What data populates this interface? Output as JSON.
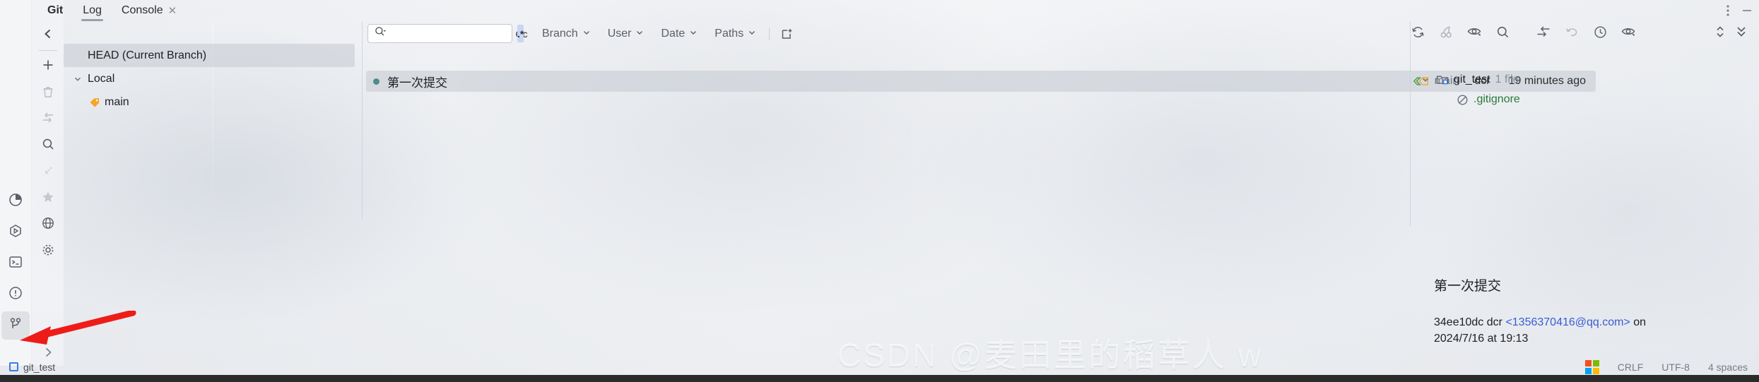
{
  "window": {
    "title": "Git",
    "tabs": [
      {
        "label": "Log",
        "selected": true,
        "closable": false
      },
      {
        "label": "Console",
        "selected": false,
        "closable": true
      }
    ],
    "more_options_icon": "vertical-dots-icon",
    "minimize_icon": "minimize-icon"
  },
  "tool_strip": {
    "items": [
      {
        "icon": "pie-chart-icon",
        "name": "project-statistics",
        "active": false
      },
      {
        "icon": "run-hexagon-icon",
        "name": "run-panel",
        "active": false
      },
      {
        "icon": "terminal-icon",
        "name": "terminal-panel",
        "active": false
      },
      {
        "icon": "problems-icon",
        "name": "problems-panel",
        "active": false
      },
      {
        "icon": "git-branch-icon",
        "name": "git-panel",
        "active": true
      }
    ]
  },
  "side_toolbar": {
    "items": [
      {
        "icon": "chevron-left-icon",
        "name": "collapse-panel",
        "dim": false
      },
      {
        "icon": "plus-icon",
        "name": "new-branch",
        "dim": false
      },
      {
        "icon": "trash-icon",
        "name": "delete-branch",
        "dim": true
      },
      {
        "icon": "merge-arrow-icon",
        "name": "merge-branch",
        "dim": true
      },
      {
        "icon": "search-icon",
        "name": "search-branches",
        "dim": false
      },
      {
        "icon": "collapse-all-icon",
        "name": "collapse-all",
        "dim": true
      },
      {
        "icon": "star-icon",
        "name": "favorite-branch",
        "dim": true
      },
      {
        "icon": "globe-icon",
        "name": "remote-branches",
        "dim": false
      },
      {
        "icon": "gear-icon",
        "name": "git-settings",
        "dim": false
      },
      {
        "icon": "chevron-right-icon",
        "name": "expand-panel",
        "dim": false
      }
    ]
  },
  "branch_tree": {
    "rows": [
      {
        "label": "HEAD (Current Branch)",
        "indent": 0,
        "selected": true,
        "chevron": "",
        "icon": ""
      },
      {
        "label": "Local",
        "indent": 0,
        "selected": false,
        "chevron": "down",
        "icon": ""
      },
      {
        "label": "main",
        "indent": 1,
        "selected": false,
        "chevron": "",
        "icon": "branch-tag-icon"
      }
    ]
  },
  "search": {
    "value": "",
    "placeholder": "",
    "search_icon": "search-dropdown-icon",
    "regex_label": ".*",
    "regex_active": true,
    "case_label": "Cc",
    "case_active": false
  },
  "filters": [
    {
      "label": "Branch",
      "name": "branch-filter"
    },
    {
      "label": "User",
      "name": "user-filter"
    },
    {
      "label": "Date",
      "name": "date-filter"
    },
    {
      "label": "Paths",
      "name": "paths-filter"
    }
  ],
  "toolbar_right": {
    "new_tab_icon": "new-log-tab-icon",
    "icons": [
      {
        "icon": "refresh-icon",
        "name": "refresh-log",
        "dim": false
      },
      {
        "icon": "cherry-pick-icon",
        "name": "cherry-pick",
        "dim": true
      },
      {
        "icon": "eye-icon",
        "name": "show-options",
        "dim": false
      },
      {
        "icon": "search-icon",
        "name": "search-commits",
        "dim": false
      }
    ],
    "icons2": [
      {
        "icon": "merge-arrow-icon",
        "name": "show-merge-commits",
        "dim": false
      },
      {
        "icon": "undo-icon",
        "name": "revert-commit",
        "dim": true
      },
      {
        "icon": "clock-icon",
        "name": "commit-history",
        "dim": false
      },
      {
        "icon": "eye-icon",
        "name": "diff-preview-options",
        "dim": false
      }
    ],
    "expand_icon": "expand-collapse-icon",
    "hide_icon": "hide-panel-icon"
  },
  "commit": {
    "subject": "第一次提交",
    "dot_color": "#4f8b91",
    "ref": "main",
    "ref_tag_icon": "branch-label-icon",
    "author": "dcr",
    "time": "19 minutes ago"
  },
  "changes": {
    "root": {
      "label": "git_test",
      "count": "1 file",
      "icon": "folder-icon",
      "chevron": "down"
    },
    "files": [
      {
        "label": ".gitignore",
        "icon": "ignored-file-icon"
      }
    ]
  },
  "detail": {
    "subject": "第一次提交",
    "hash": "34ee10dc",
    "author": "dcr",
    "email": "<1356370416@qq.com>",
    "connector": "on",
    "date": "2024/7/16 at 19:13"
  },
  "statusbar": {
    "project": "git_test",
    "project_icon": "project-icon",
    "os_icon": "windows-logo-icon",
    "line_separator": "CRLF",
    "encoding": "UTF-8",
    "indent": "4 spaces"
  },
  "watermark": {
    "text": "CSDN @麦田里的稻草人 w"
  },
  "annotation": {
    "arrow_color": "#ee1c18",
    "points_to": "git-panel"
  }
}
